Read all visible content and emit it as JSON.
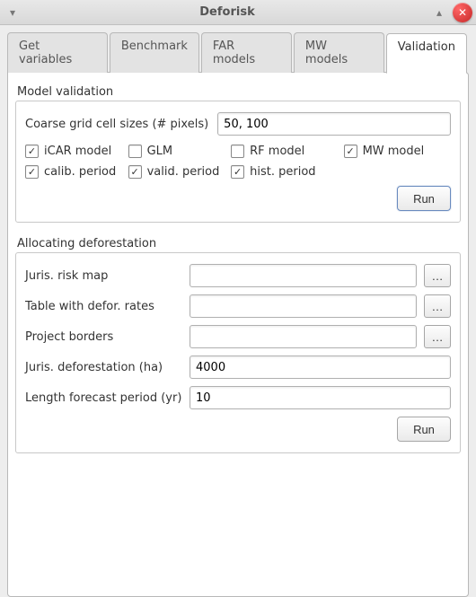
{
  "window": {
    "title": "Deforisk"
  },
  "tabs": [
    {
      "label": "Get variables",
      "active": false
    },
    {
      "label": "Benchmark",
      "active": false
    },
    {
      "label": "FAR models",
      "active": false
    },
    {
      "label": "MW models",
      "active": false
    },
    {
      "label": "Validation",
      "active": true
    }
  ],
  "validation": {
    "section_label": "Model validation",
    "coarse_label": "Coarse grid cell sizes (# pixels)",
    "coarse_value": "50, 100",
    "checks": [
      {
        "label": "iCAR model",
        "checked": true
      },
      {
        "label": "GLM",
        "checked": false
      },
      {
        "label": "RF model",
        "checked": false
      },
      {
        "label": "MW model",
        "checked": true
      },
      {
        "label": "calib. period",
        "checked": true
      },
      {
        "label": "valid. period",
        "checked": true
      },
      {
        "label": "hist. period",
        "checked": true
      }
    ],
    "run_label": "Run"
  },
  "allocating": {
    "section_label": "Allocating deforestation",
    "fields": [
      {
        "label": "Juris. risk map",
        "value": "",
        "browse": true
      },
      {
        "label": "Table with defor. rates",
        "value": "",
        "browse": true
      },
      {
        "label": "Project borders",
        "value": "",
        "browse": true
      },
      {
        "label": "Juris. deforestation (ha)",
        "value": "4000",
        "browse": false
      },
      {
        "label": "Length forecast period (yr)",
        "value": "10",
        "browse": false
      }
    ],
    "browse_label": "…",
    "run_label": "Run"
  }
}
